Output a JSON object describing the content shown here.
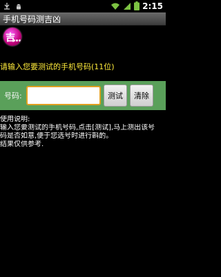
{
  "status_bar": {
    "time": "2:15",
    "left_icons": [
      "usb-icon",
      "android-debug-icon"
    ],
    "right_icons": [
      "wifi-icon",
      "signal-icon",
      "battery-icon"
    ]
  },
  "title_bar": {
    "title": "手机号码测吉凶"
  },
  "logo": {
    "char": "吉"
  },
  "prompt": "请输入您要测试的手机号码(11位)",
  "form": {
    "label": "号码:",
    "value": "",
    "test_label": "测试",
    "clear_label": "清除"
  },
  "instructions": {
    "heading": "使用说明:",
    "lines": [
      " 输入您要测试的手机号码,点击[测试],马上测出该号",
      "码是否如意,便于您选号时进行斟酌。",
      " 结果仅供参考."
    ]
  },
  "colors": {
    "background": "#000000",
    "prompt_text": "#ffeb3b",
    "input_panel": "#5aa05a",
    "input_border": "#e0a020"
  }
}
